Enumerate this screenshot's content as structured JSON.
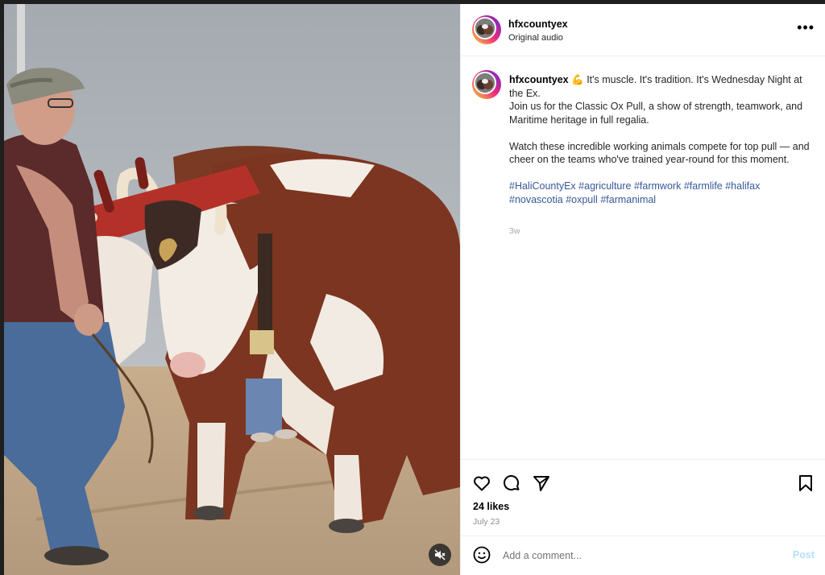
{
  "post": {
    "username": "hfxcountyex",
    "audio": "Original audio",
    "more_icon": "more-horizontal-icon",
    "caption": {
      "username": "hfxcountyex",
      "emoji": "💪",
      "line1": "It's muscle. It's tradition. It's Wednesday Night at the Ex.",
      "line2": "Join us for the Classic Ox Pull, a show of strength, teamwork, and Maritime heritage in full regalia.",
      "line3": "Watch these incredible working animals compete for top pull — and cheer on the teams who've trained year-round for this moment.",
      "hashtags": [
        "#HaliCountyEx",
        "#agriculture",
        "#farmwork",
        "#farmlife",
        "#halifax",
        "#novascotia",
        "#oxpull",
        "#farmanimal"
      ]
    },
    "age": "3w",
    "likes": "24 likes",
    "date": "July 23",
    "comment_placeholder": "Add a comment...",
    "post_label": "Post"
  },
  "colors": {
    "hashtag": "#385898",
    "post_disabled": "#b2dffc",
    "muted_text": "#8e8e8e"
  },
  "icons": {
    "like": "heart-icon",
    "comment": "comment-icon",
    "share": "send-icon",
    "save": "bookmark-icon",
    "emoji": "emoji-icon",
    "mute": "speaker-muted-icon"
  }
}
